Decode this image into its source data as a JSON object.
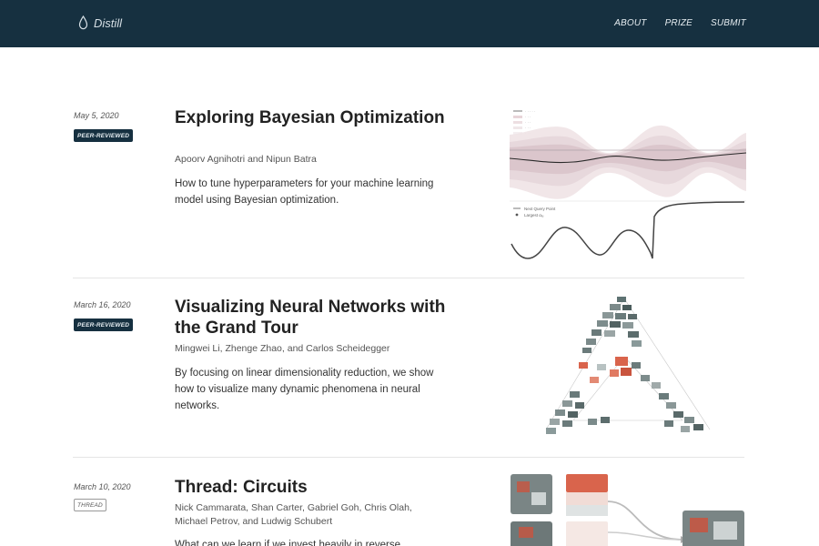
{
  "header": {
    "logo_text": "Distill",
    "logo_icon": "droplet-icon",
    "nav": [
      "ABOUT",
      "PRIZE",
      "SUBMIT"
    ]
  },
  "articles": [
    {
      "date": "May 5, 2020",
      "badge": "PEER-REVIEWED",
      "title": "Exploring Bayesian Optimization",
      "authors": "Apoorv Agnihotri and Nipun Batra",
      "description": "How to tune hyperparameters for your machine learning model using Bayesian optimization.",
      "thumbnail_legend": [
        "Next Query Point",
        "Largest αᵢᵤ"
      ]
    },
    {
      "date": "March 16, 2020",
      "badge": "PEER-REVIEWED",
      "title": "Visualizing Neural Networks with the Grand Tour",
      "authors": "Mingwei Li, Zhenge Zhao, and Carlos Scheidegger",
      "description": "By focusing on linear dimensionality reduction, we show how to visualize many dynamic phenomena in neural networks."
    },
    {
      "date": "March 10, 2020",
      "badge": "THREAD",
      "title": "Thread: Circuits",
      "authors": "Nick Cammarata, Shan Carter, Gabriel Goh, Chris Olah, Michael Petrov, and Ludwig Schubert",
      "description": "What can we learn if we invest heavily in reverse"
    }
  ],
  "colors": {
    "header_bg": "#163040",
    "badge_peer_bg": "#163040",
    "accent_red": "#d9644c"
  }
}
